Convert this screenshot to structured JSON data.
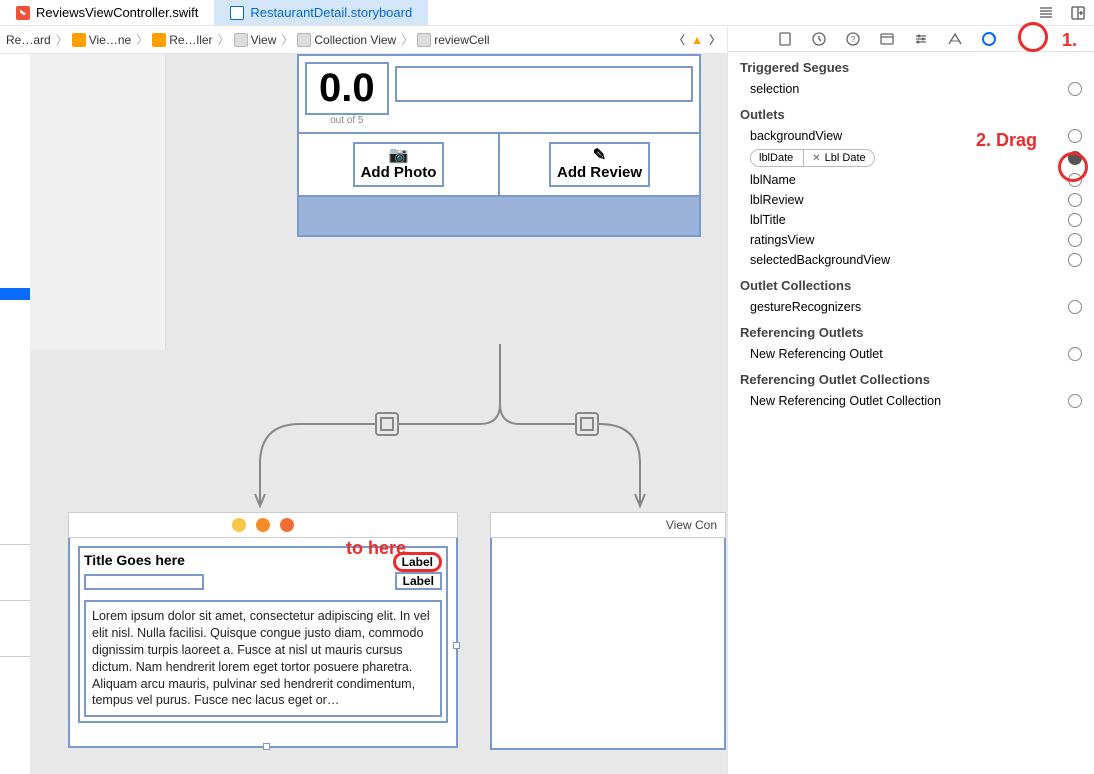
{
  "tabs": {
    "tab0": "ReviewsViewController.swift",
    "tab1": "RestaurantDetail.storyboard"
  },
  "jumpbar": {
    "seg0": "Re…ard",
    "seg1": "Vie…ne",
    "seg2": "Re…ller",
    "seg3": "View",
    "seg4": "Collection View",
    "seg5": "reviewCell"
  },
  "canvas": {
    "rating": "0.0",
    "rating_sub": "out of 5",
    "add_photo": "Add Photo",
    "add_review": "Add Review",
    "vc2_title": "View Con",
    "cell_title": "Title Goes here",
    "label1": "Label",
    "label2": "Label",
    "lorem": "Lorem ipsum dolor sit amet, consectetur adipiscing elit. In vel elit nisl. Nulla facilisi. Quisque congue justo diam, commodo dignissim turpis laoreet a. Fusce at nisl ut mauris cursus dictum. Nam hendrerit lorem eget tortor posuere pharetra. Aliquam arcu mauris, pulvinar sed hendrerit condimentum, tempus vel purus. Fusce nec lacus eget or…"
  },
  "annot": {
    "one": "1.",
    "two": "2. Drag",
    "tohere": "to here"
  },
  "inspector": {
    "sec_segues": "Triggered Segues",
    "selection": "selection",
    "sec_outlets": "Outlets",
    "backgroundView": "backgroundView",
    "lblDate": "lblDate",
    "lblDate_dest": "Lbl Date",
    "lblName": "lblName",
    "lblReview": "lblReview",
    "lblTitle": "lblTitle",
    "ratingsView": "ratingsView",
    "selectedBackgroundView": "selectedBackgroundView",
    "sec_outletcol": "Outlet Collections",
    "gestureRecognizers": "gestureRecognizers",
    "sec_refout": "Referencing Outlets",
    "newRefOutlet": "New Referencing Outlet",
    "sec_refoutcol": "Referencing Outlet Collections",
    "newRefOutletCol": "New Referencing Outlet Collection"
  }
}
